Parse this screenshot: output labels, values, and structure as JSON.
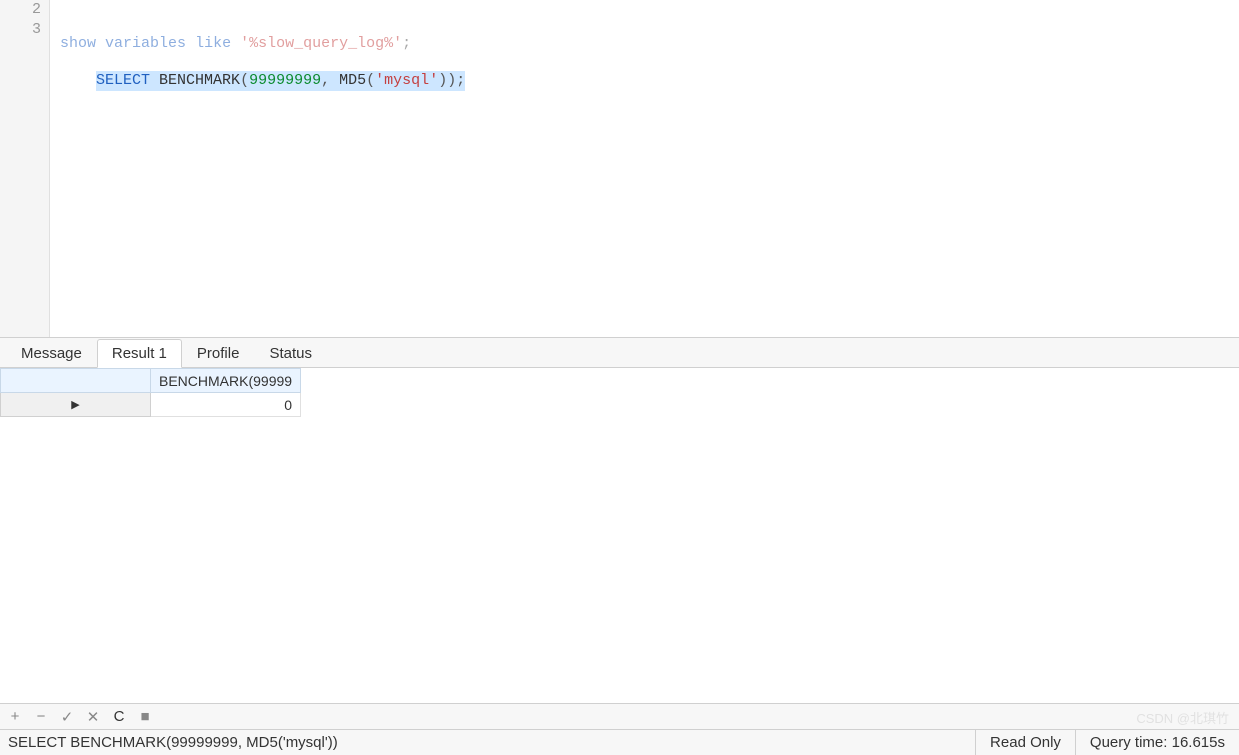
{
  "editor": {
    "lines": [
      {
        "number": "2",
        "tokens": {
          "kw1": "show",
          "kw2": "variables",
          "kw3": "like",
          "strq1": "'",
          "str": "%slow_query_log%",
          "strq2": "'",
          "semi": ";"
        }
      },
      {
        "number": "3",
        "tokens": {
          "kw1": "SELECT",
          "fn1": "BENCHMARK",
          "lp1": "(",
          "num1": "99999999",
          "comma": ",",
          "sp": " ",
          "fn2": "MD5",
          "lp2": "(",
          "strq1": "'",
          "str": "mysql",
          "strq2": "'",
          "rp2": ")",
          "rp1": ")",
          "semi": ";"
        }
      }
    ]
  },
  "tabs": [
    {
      "label": "Message",
      "active": false
    },
    {
      "label": "Result 1",
      "active": true
    },
    {
      "label": "Profile",
      "active": false
    },
    {
      "label": "Status",
      "active": false
    }
  ],
  "result": {
    "column_header": "BENCHMARK(99999",
    "row_indicator": "▶",
    "value": "0"
  },
  "toolbar": {
    "add": "+",
    "remove": "−",
    "check": "✓",
    "cancel": "✕",
    "refresh": "C",
    "stop": "■"
  },
  "status": {
    "query": "SELECT BENCHMARK(99999999, MD5('mysql'))",
    "readonly": "Read Only",
    "querytime": "Query time: 16.615s"
  },
  "watermark": "CSDN @北琪竹"
}
